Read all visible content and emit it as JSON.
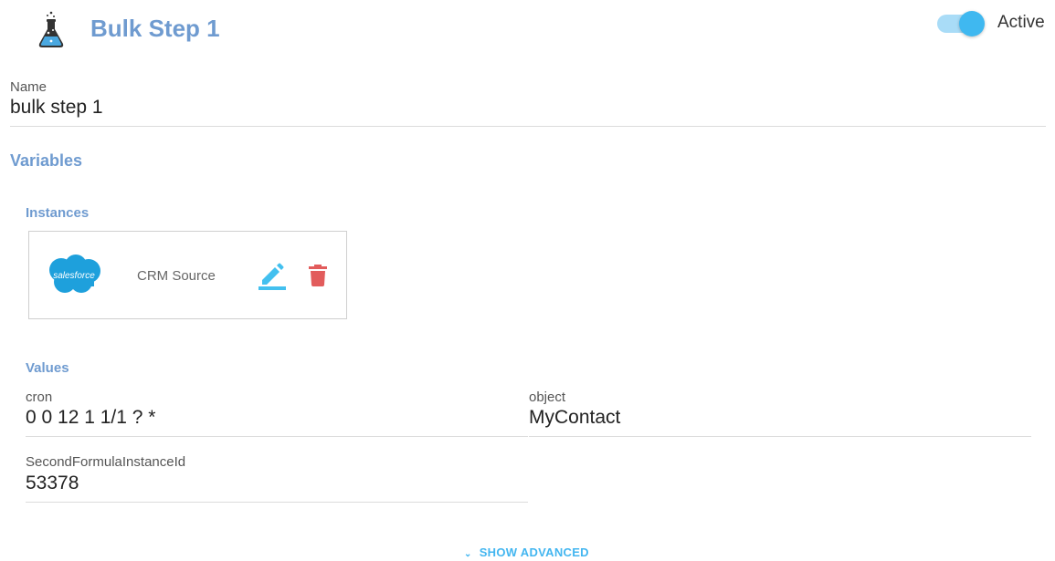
{
  "header": {
    "title": "Bulk Step 1",
    "icon": "flask-icon",
    "active_label": "Active",
    "active": true
  },
  "name_field": {
    "label": "Name",
    "value": "bulk step 1"
  },
  "variables": {
    "title": "Variables"
  },
  "instances": {
    "title": "Instances",
    "items": [
      {
        "logo_text": "salesforce",
        "name": "CRM Source",
        "edit_icon": "pencil-icon",
        "delete_icon": "trash-icon"
      }
    ]
  },
  "values": {
    "title": "Values",
    "cron": {
      "label": "cron",
      "value": "0 0 12 1 1/1 ? *"
    },
    "object": {
      "label": "object",
      "value": "MyContact"
    },
    "second_formula": {
      "label": "SecondFormulaInstanceId",
      "value": "53378"
    }
  },
  "footer": {
    "show_advanced_label": "SHOW ADVANCED",
    "chevron_icon": "chevron-down-icon"
  },
  "colors": {
    "accent_title": "#6f9bd0",
    "toggle_knob": "#3fb8f0",
    "edit": "#43c0ef",
    "delete": "#e25c5c",
    "link": "#43b6f0"
  }
}
